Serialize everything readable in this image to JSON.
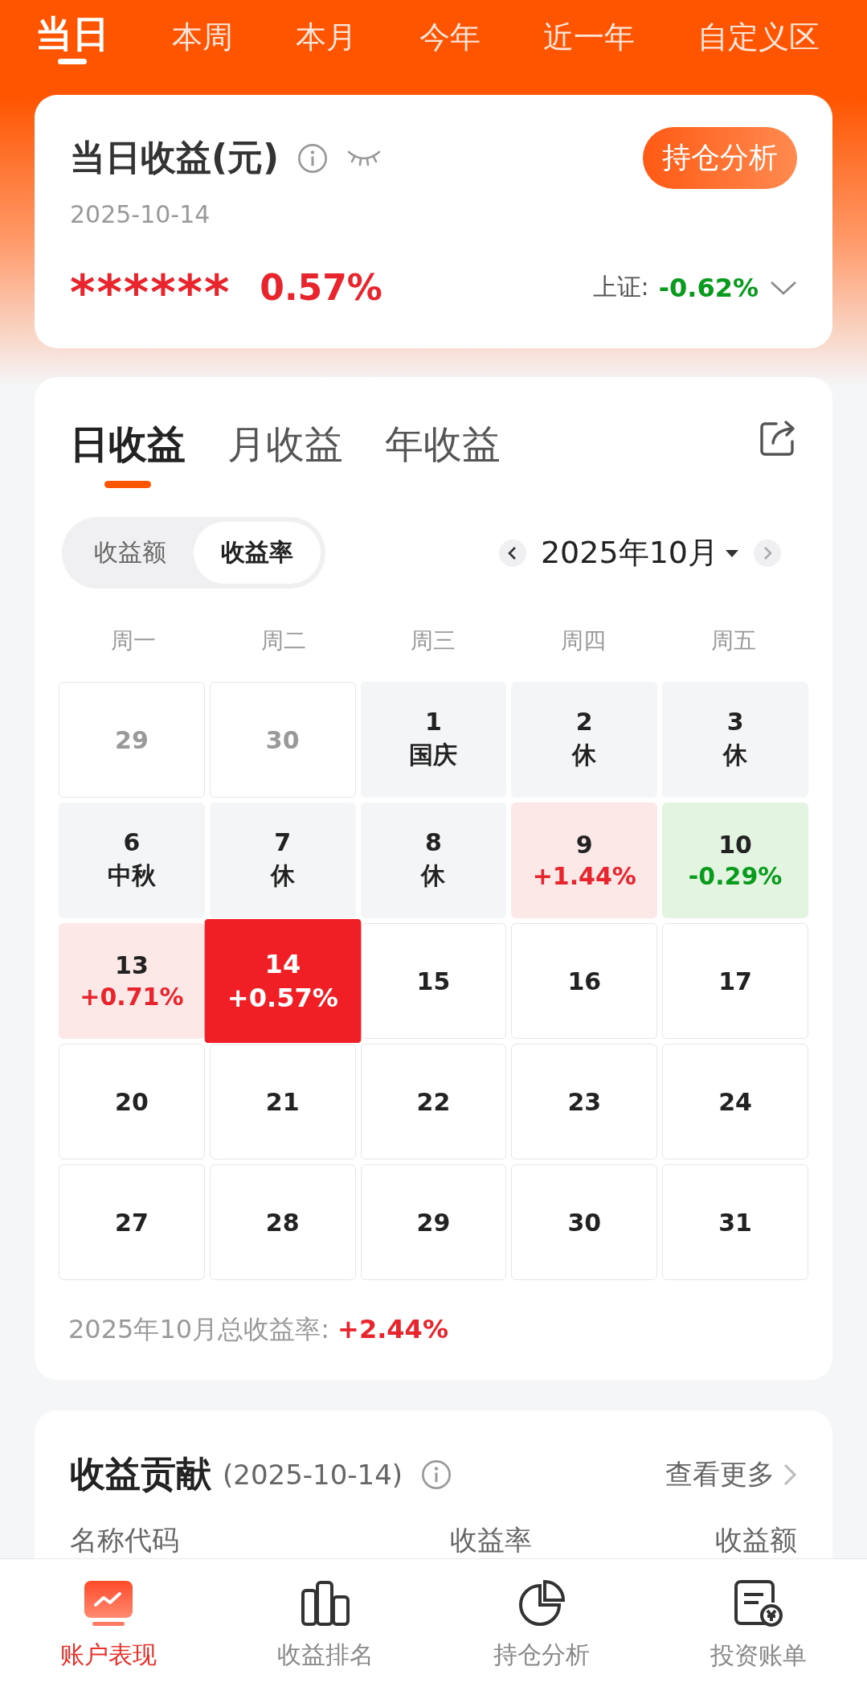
{
  "period_tabs": [
    {
      "label": "当日",
      "selected": true
    },
    {
      "label": "本周",
      "selected": false
    },
    {
      "label": "本月",
      "selected": false
    },
    {
      "label": "今年",
      "selected": false
    },
    {
      "label": "近一年",
      "selected": false
    },
    {
      "label": "自定义区",
      "selected": false
    }
  ],
  "summary": {
    "title": "当日收益(元)",
    "date": "2025-10-14",
    "amount": "******",
    "rate": "0.57%",
    "button": "持仓分析",
    "index_label": "上证:",
    "index_value": "-0.62%"
  },
  "profit_tabs": [
    {
      "label": "日收益",
      "selected": true
    },
    {
      "label": "月收益",
      "selected": false
    },
    {
      "label": "年收益",
      "selected": false
    }
  ],
  "toggle": [
    {
      "label": "收益额",
      "selected": false
    },
    {
      "label": "收益率",
      "selected": true
    }
  ],
  "month": "2025年10月",
  "weekdays": [
    "周一",
    "周二",
    "周三",
    "周四",
    "周五"
  ],
  "days": [
    {
      "day": "29",
      "kind": "other-month",
      "selected": false
    },
    {
      "day": "30",
      "kind": "other-month",
      "selected": false
    },
    {
      "day": "1",
      "sub": "国庆",
      "kind": "holiday",
      "selected": false
    },
    {
      "day": "2",
      "sub": "休",
      "kind": "holiday",
      "selected": false
    },
    {
      "day": "3",
      "sub": "休",
      "kind": "holiday",
      "selected": false
    },
    {
      "day": "6",
      "sub": "中秋",
      "kind": "holiday",
      "selected": false
    },
    {
      "day": "7",
      "sub": "休",
      "kind": "holiday",
      "selected": false
    },
    {
      "day": "8",
      "sub": "休",
      "kind": "holiday",
      "selected": false
    },
    {
      "day": "9",
      "sub": "+1.44%",
      "kind": "gain",
      "selected": false
    },
    {
      "day": "10",
      "sub": "-0.29%",
      "kind": "loss",
      "selected": false
    },
    {
      "day": "13",
      "sub": "+0.71%",
      "kind": "gain",
      "selected": false
    },
    {
      "day": "14",
      "sub": "+0.57%",
      "kind": "gain",
      "selected": true
    },
    {
      "day": "15",
      "kind": "normal",
      "selected": false
    },
    {
      "day": "16",
      "kind": "normal",
      "selected": false
    },
    {
      "day": "17",
      "kind": "normal",
      "selected": false
    },
    {
      "day": "20",
      "kind": "normal",
      "selected": false
    },
    {
      "day": "21",
      "kind": "normal",
      "selected": false
    },
    {
      "day": "22",
      "kind": "normal",
      "selected": false
    },
    {
      "day": "23",
      "kind": "normal",
      "selected": false
    },
    {
      "day": "24",
      "kind": "normal",
      "selected": false
    },
    {
      "day": "27",
      "kind": "normal",
      "selected": false
    },
    {
      "day": "28",
      "kind": "normal",
      "selected": false
    },
    {
      "day": "29",
      "kind": "normal",
      "selected": false
    },
    {
      "day": "30",
      "kind": "normal",
      "selected": false
    },
    {
      "day": "31",
      "kind": "normal",
      "selected": false
    }
  ],
  "month_total": {
    "label": "2025年10月总收益率:",
    "value": "+2.44%"
  },
  "contribution": {
    "title": "收益贡献",
    "date": "(2025-10-14)",
    "more": "查看更多",
    "columns": [
      "名称代码",
      "收益率",
      "收益额"
    ]
  },
  "bottom_nav": [
    {
      "label": "账户表现",
      "kind": "chart",
      "selected": true
    },
    {
      "label": "收益排名",
      "kind": "bars",
      "selected": false
    },
    {
      "label": "持仓分析",
      "kind": "pie",
      "selected": false
    },
    {
      "label": "投资账单",
      "kind": "bill",
      "selected": false
    }
  ]
}
